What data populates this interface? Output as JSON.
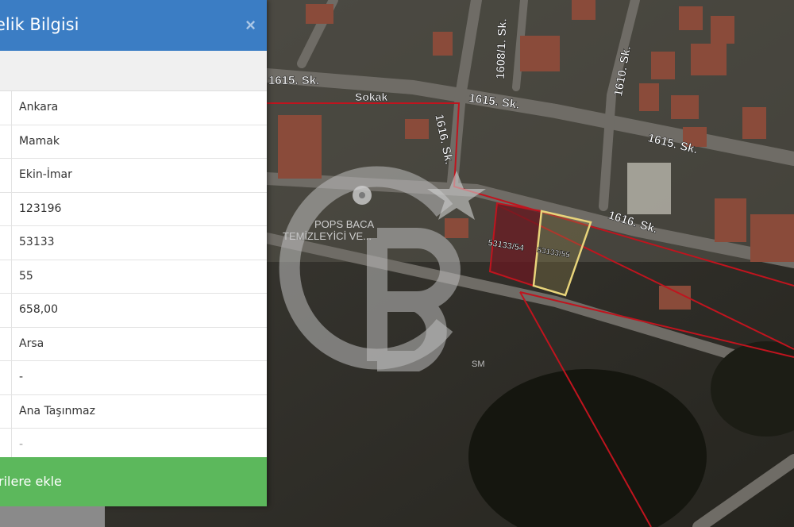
{
  "panel": {
    "title": "elik Bilgisi",
    "close_icon": "×",
    "rows": [
      {
        "value": "Ankara"
      },
      {
        "value": "Mamak"
      },
      {
        "value": "Ekin-İmar"
      },
      {
        "value": "123196"
      },
      {
        "value": "53133"
      },
      {
        "value": "55"
      },
      {
        "value": "658,00"
      },
      {
        "value": "Arsa"
      },
      {
        "value": "-"
      },
      {
        "value": "Ana Taşınmaz"
      },
      {
        "value": "-"
      }
    ],
    "add_button": "rilere ekle"
  },
  "map": {
    "streets": [
      "1615. Sk.",
      "Sokak",
      "1615. Sk.",
      "1615. Sk.",
      "1616. Sk.",
      "1616. Sk.",
      "1608/1. Sk.",
      "1610. Sk."
    ],
    "parcels": [
      "53133/54",
      "53133/55"
    ],
    "poi": [
      "POPS BACA",
      "TEMİZLEYİCİ VE..."
    ],
    "watermark": "CB",
    "watermark_mark": "SM",
    "colors": {
      "boundary": "#c0141e",
      "selected_parcel": "#e8d47a",
      "panel_header": "#3b7dc4",
      "add_button": "#5cb85c"
    }
  }
}
